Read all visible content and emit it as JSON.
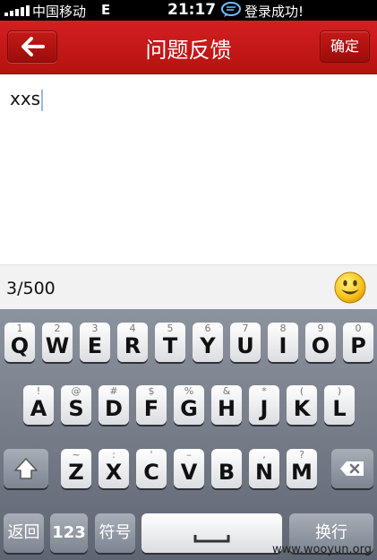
{
  "status_bar": {
    "carrier": "中国移动",
    "network": "E",
    "time": "21:17",
    "toast": "登录成功!"
  },
  "nav": {
    "title": "问题反馈",
    "confirm_label": "确定",
    "back_icon": "arrow-left-icon",
    "bar_color": "#c81a1a"
  },
  "feedback": {
    "text": "xxs",
    "count": "3/500"
  },
  "keyboard": {
    "row1": [
      {
        "sym": "1",
        "key": "Q"
      },
      {
        "sym": "2",
        "key": "W"
      },
      {
        "sym": "3",
        "key": "E"
      },
      {
        "sym": "4",
        "key": "R"
      },
      {
        "sym": "5",
        "key": "T"
      },
      {
        "sym": "6",
        "key": "Y"
      },
      {
        "sym": "7",
        "key": "U"
      },
      {
        "sym": "8",
        "key": "I"
      },
      {
        "sym": "9",
        "key": "O"
      },
      {
        "sym": "0",
        "key": "P"
      }
    ],
    "row2": [
      {
        "sym": "!",
        "key": "A"
      },
      {
        "sym": "@",
        "key": "S"
      },
      {
        "sym": "#",
        "key": "D"
      },
      {
        "sym": "$",
        "key": "F"
      },
      {
        "sym": "%",
        "key": "G"
      },
      {
        "sym": "&",
        "key": "H"
      },
      {
        "sym": "*",
        "key": "J"
      },
      {
        "sym": "(",
        "key": "K"
      },
      {
        "sym": ")",
        "key": "L"
      }
    ],
    "row3": [
      {
        "sym": "~",
        "key": "Z"
      },
      {
        "sym": ":",
        "key": "X"
      },
      {
        "sym": "'",
        "key": "C"
      },
      {
        "sym": "–",
        "key": "V"
      },
      {
        "sym": "",
        "key": "B"
      },
      {
        "sym": ",",
        "key": "N"
      },
      {
        "sym": "?",
        "key": "M"
      }
    ],
    "back_label": "返回",
    "num_label": "123",
    "symbol_label": "符号",
    "enter_label": "换行"
  },
  "watermark": "www.wooyun.org"
}
